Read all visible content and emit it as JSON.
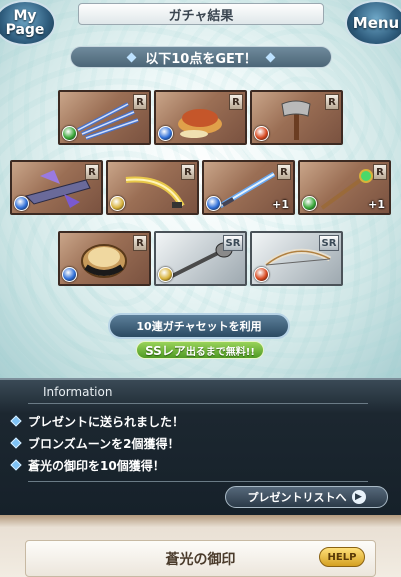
{
  "header": {
    "title": "ガチャ結果",
    "mypage_label_1": "My",
    "mypage_label_2": "Page",
    "menu_label": "Menu"
  },
  "result": {
    "banner": "以下10点をGET！"
  },
  "items": [
    {
      "rarity": "R",
      "element": "wind",
      "plus": "",
      "art": "claw"
    },
    {
      "rarity": "R",
      "element": "water",
      "plus": "",
      "art": "bowl"
    },
    {
      "rarity": "R",
      "element": "fire",
      "plus": "",
      "art": "axe"
    },
    {
      "rarity": "R",
      "element": "water",
      "plus": "",
      "art": "gun"
    },
    {
      "rarity": "R",
      "element": "light",
      "plus": "",
      "art": "scimitar"
    },
    {
      "rarity": "R",
      "element": "water",
      "plus": "+1",
      "art": "sword"
    },
    {
      "rarity": "R",
      "element": "wind",
      "plus": "+1",
      "art": "staff"
    },
    {
      "rarity": "R",
      "element": "water",
      "plus": "",
      "art": "drum"
    },
    {
      "rarity": "SR",
      "element": "light",
      "plus": "",
      "art": "mace"
    },
    {
      "rarity": "SR",
      "element": "fire",
      "plus": "",
      "art": "bow"
    }
  ],
  "colors": {
    "wind": "#3aa83a",
    "water": "#2f6fd8",
    "fire": "#d8481f",
    "light": "#d8b23a"
  },
  "gacha": {
    "set_button": "10連ガチャセットを利用",
    "free_tag_prefix": "SSレア",
    "free_tag_suffix": "出るまで無料!!"
  },
  "info": {
    "heading": "Information",
    "lines": [
      "プレゼントに送られました！",
      "ブロンズムーンを2個獲得！",
      "蒼光の御印を10個獲得！"
    ],
    "present_button": "プレゼントリストへ"
  },
  "bottom": {
    "item_name": "蒼光の御印",
    "help": "HELP"
  }
}
